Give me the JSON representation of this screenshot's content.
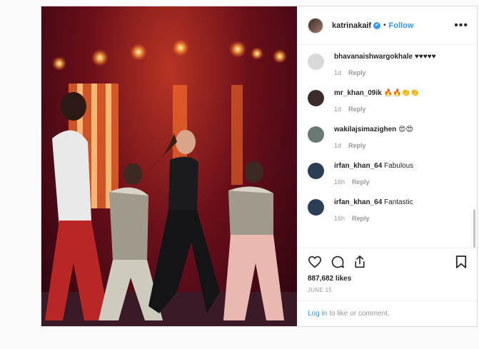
{
  "header": {
    "username": "katrinakaif",
    "verified_mark": "✔",
    "separator": "•",
    "follow_label": "Follow",
    "more_label": "•••"
  },
  "comments": [
    {
      "user": "bhavanaishwargokhale",
      "text": "♥♥♥♥♥",
      "time": "1d",
      "reply": "Reply",
      "avatar_color": "#d9d9d9"
    },
    {
      "user": "mr_khan_09ik",
      "text": "🔥🔥👏👏",
      "time": "1d",
      "reply": "Reply",
      "avatar_color": "#3a2c2a"
    },
    {
      "user": "wakilajsimazighen",
      "text": "😍😍",
      "time": "1d",
      "reply": "Reply",
      "avatar_color": "#6a7a72"
    },
    {
      "user": "irfan_khan_64",
      "text": "Fabulous",
      "time": "16h",
      "reply": "Reply",
      "avatar_color": "#2b3e55"
    },
    {
      "user": "irfan_khan_64",
      "text": "Fantastic",
      "time": "16h",
      "reply": "Reply",
      "avatar_color": "#2b3e55"
    }
  ],
  "actions": {
    "like_icon": "heart-icon",
    "comment_icon": "comment-icon",
    "share_icon": "share-icon",
    "save_icon": "bookmark-icon"
  },
  "likes": "887,682 likes",
  "date": "JUNE 15",
  "login": {
    "link": "Log in",
    "text": "to like or comment."
  }
}
